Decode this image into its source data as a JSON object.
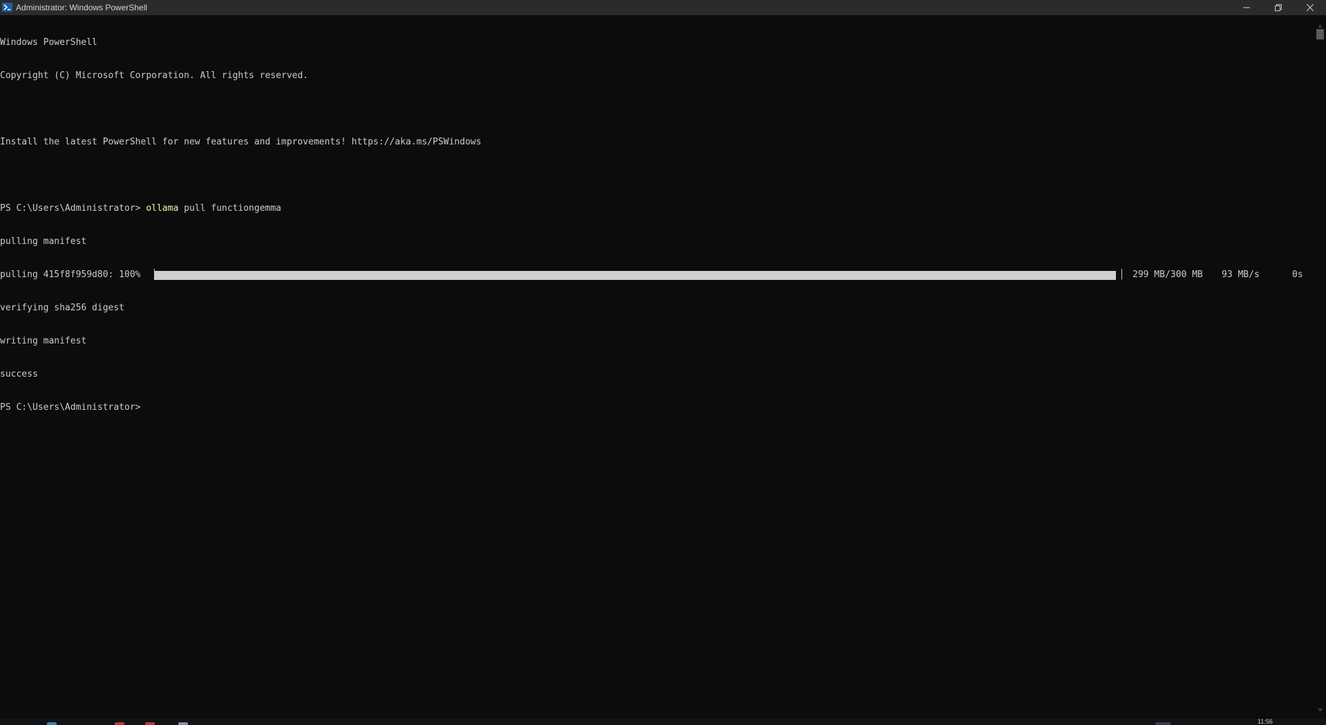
{
  "window": {
    "title": "Administrator: Windows PowerShell",
    "icon": "powershell-icon",
    "controls": {
      "minimize": "minimize-icon",
      "maximize": "restore-icon",
      "close": "close-icon"
    }
  },
  "console": {
    "lines": [
      "Windows PowerShell",
      "Copyright (C) Microsoft Corporation. All rights reserved.",
      "",
      "Install the latest PowerShell for new features and improvements! https://aka.ms/PSWindows",
      ""
    ],
    "command_prompt": "PS C:\\Users\\Administrator> ",
    "command_name": "ollama",
    "command_args": " pull functiongemma",
    "pulling_manifest": "pulling manifest",
    "progress": {
      "label": "pulling 415f8f959d80: 100% ",
      "bar_open": "▕",
      "fraction": 1.0,
      "bar_close": "▏",
      "size": "299 MB/300 MB",
      "speed": "93 MB/s",
      "eta": "0s"
    },
    "after_lines": [
      "verifying sha256 digest",
      "writing manifest",
      "success"
    ],
    "final_prompt": "PS C:\\Users\\Administrator>"
  },
  "taskbar": {
    "clock": "11:56"
  },
  "colors": {
    "background": "#0c0c0c",
    "text": "#cccccc",
    "command": "#f9f1a5",
    "progress_fill": "#d0d0d0",
    "titlebar": "#2b2b2b"
  }
}
